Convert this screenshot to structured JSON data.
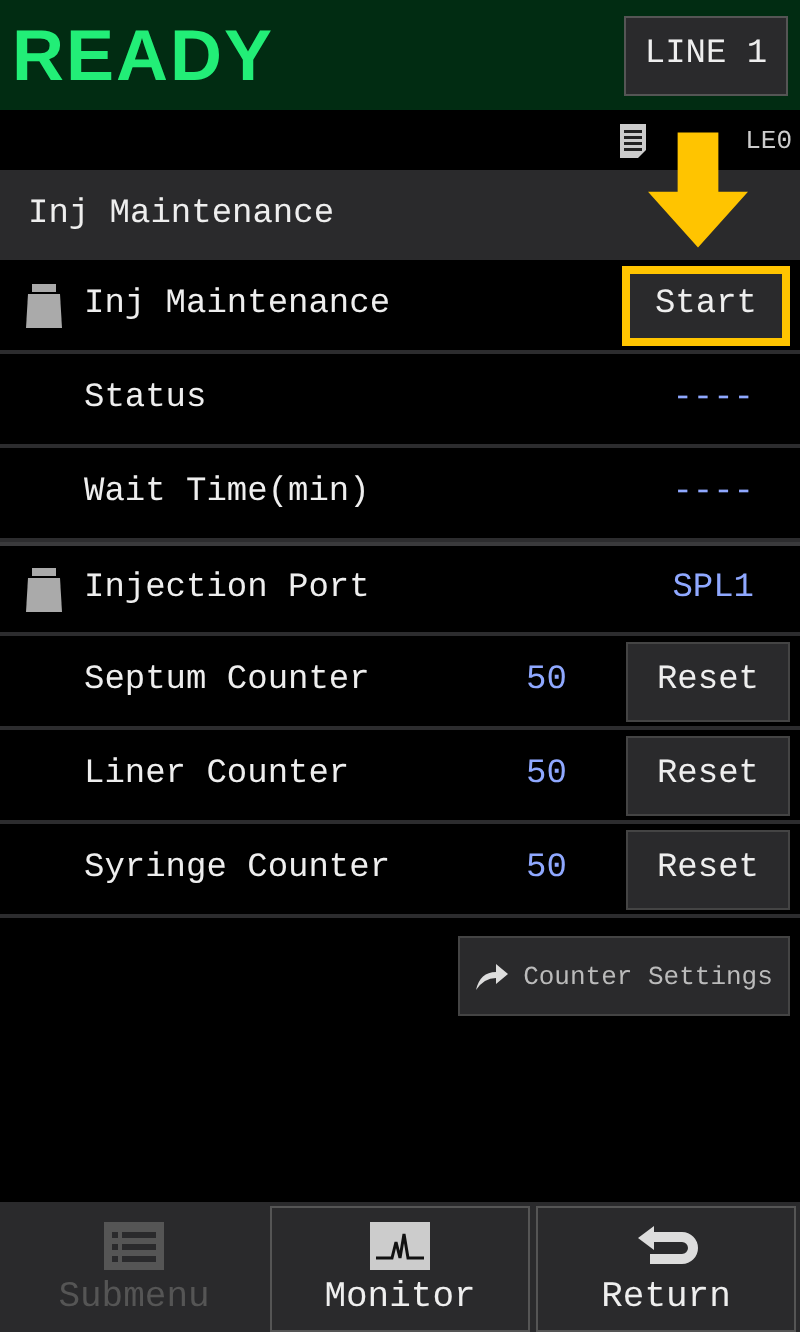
{
  "header": {
    "status": "READY",
    "line_button": "LINE 1"
  },
  "file_bar": {
    "label": "LE0"
  },
  "section": {
    "title": "Inj Maintenance"
  },
  "rows": [
    {
      "kind": "action",
      "icon": true,
      "label": "Inj Maintenance",
      "button": "Start",
      "highlighted": true
    },
    {
      "kind": "value",
      "icon": false,
      "label": "Status",
      "value": "----"
    },
    {
      "kind": "value",
      "icon": false,
      "label": "Wait Time(min)",
      "value": "----"
    },
    {
      "kind": "value",
      "icon": true,
      "label": "Injection Port",
      "value": "SPL1"
    },
    {
      "kind": "counter",
      "icon": false,
      "label": "Septum Counter",
      "value": "50",
      "button": "Reset"
    },
    {
      "kind": "counter",
      "icon": false,
      "label": "Liner Counter",
      "value": "50",
      "button": "Reset"
    },
    {
      "kind": "counter",
      "icon": false,
      "label": "Syringe Counter",
      "value": "50",
      "button": "Reset"
    }
  ],
  "settings_button": "Counter Settings",
  "footer": [
    {
      "kind": "submenu",
      "label": "Submenu",
      "disabled": true
    },
    {
      "kind": "monitor",
      "label": "Monitor",
      "disabled": false
    },
    {
      "kind": "return",
      "label": "Return",
      "disabled": false
    }
  ]
}
